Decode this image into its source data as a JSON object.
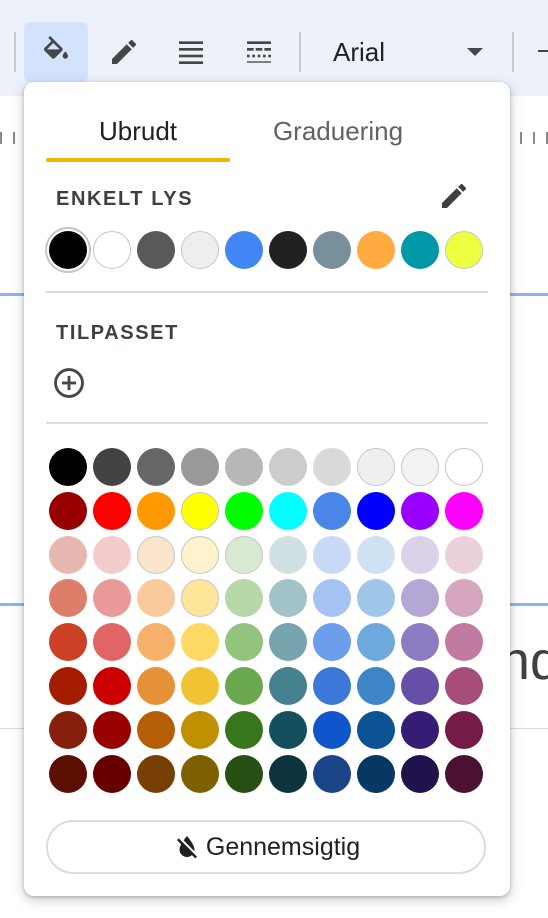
{
  "toolbar": {
    "font_name": "Arial",
    "buttons": [
      {
        "name": "fill-color-button",
        "icon": "paint-bucket-icon",
        "active": true
      },
      {
        "name": "border-color-button",
        "icon": "pencil-icon"
      },
      {
        "name": "border-weight-button",
        "icon": "line-weight-icon"
      },
      {
        "name": "border-dash-button",
        "icon": "line-dash-icon"
      }
    ]
  },
  "document": {
    "partial_text": "nd"
  },
  "popup": {
    "tabs": [
      {
        "label": "Ubrudt",
        "selected": true
      },
      {
        "label": "Graduering",
        "selected": false
      }
    ],
    "accent_color": "#f4b400",
    "theme_section_label": "ENKELT LYS",
    "theme_edit_icon": "pencil-icon",
    "theme_colors": [
      "#000000",
      "#ffffff",
      "#595959",
      "#eeeeee",
      "#4285f4",
      "#212121",
      "#78909c",
      "#ffab40",
      "#0097a7",
      "#eeff41"
    ],
    "selected_theme_color": 0,
    "custom_section_label": "TILPASSET",
    "add_custom_icon": "add-circle-icon",
    "palette": [
      [
        "#000000",
        "#434343",
        "#666666",
        "#999999",
        "#b7b7b7",
        "#cccccc",
        "#d9d9d9",
        "#efefef",
        "#f3f3f3",
        "#ffffff"
      ],
      [
        "#980000",
        "#ff0000",
        "#ff9900",
        "#ffff00",
        "#00ff00",
        "#00ffff",
        "#4a86e8",
        "#0000ff",
        "#9900ff",
        "#ff00ff"
      ],
      [
        "#e6b8af",
        "#f4cccc",
        "#fce5cd",
        "#fff2cc",
        "#d9ead3",
        "#d0e0e3",
        "#c9daf8",
        "#cfe2f3",
        "#d9d2e9",
        "#ead1dc"
      ],
      [
        "#dd7e6b",
        "#ea9999",
        "#f9cb9c",
        "#ffe599",
        "#b6d7a8",
        "#a2c4c9",
        "#a4c2f4",
        "#9fc5e8",
        "#b4a7d6",
        "#d5a6bd"
      ],
      [
        "#cc4125",
        "#e06666",
        "#f6b26b",
        "#ffd966",
        "#93c47d",
        "#76a5af",
        "#6d9eeb",
        "#6fa8dc",
        "#8e7cc3",
        "#c27ba0"
      ],
      [
        "#a61c00",
        "#cc0000",
        "#e69138",
        "#f1c232",
        "#6aa84f",
        "#45818e",
        "#3c78d8",
        "#3d85c6",
        "#674ea7",
        "#a64d79"
      ],
      [
        "#85200c",
        "#990000",
        "#b45f06",
        "#bf9000",
        "#38761d",
        "#134f5c",
        "#1155cc",
        "#0b5394",
        "#351c75",
        "#741b47"
      ],
      [
        "#5b0f00",
        "#660000",
        "#783f04",
        "#7f6000",
        "#274e13",
        "#0c343d",
        "#1c4587",
        "#073763",
        "#20124d",
        "#4c1130"
      ]
    ],
    "transparent_label": "Gennemsigtig",
    "transparent_icon": "format-color-reset-icon"
  }
}
